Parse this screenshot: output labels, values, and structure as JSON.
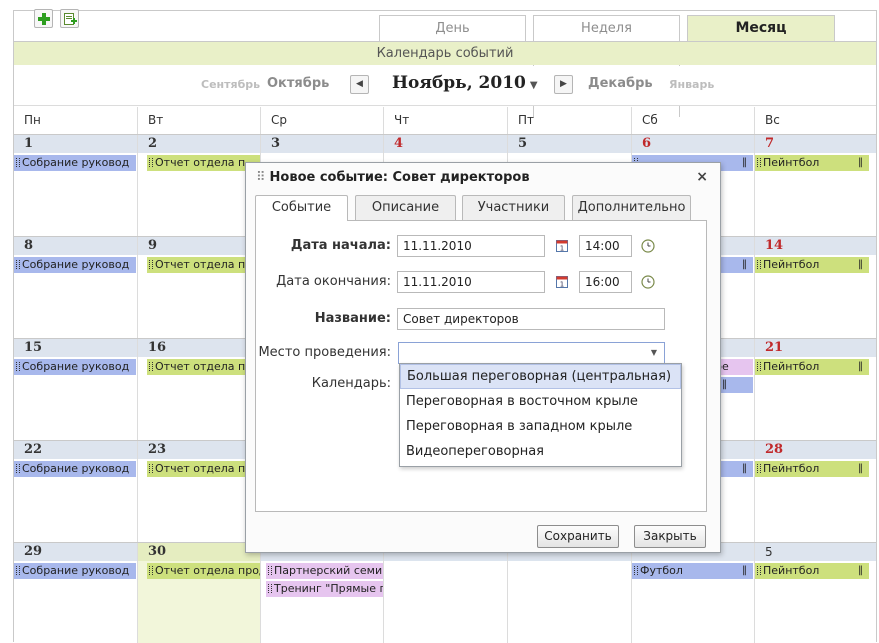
{
  "toolbar": {
    "add_icon": "plus-icon",
    "export_icon": "add-document-icon",
    "accent_green": "#2e9e1f"
  },
  "view_tabs": [
    {
      "label": "День",
      "active": false
    },
    {
      "label": "Неделя",
      "active": false
    },
    {
      "label": "Месяц",
      "active": true
    }
  ],
  "calendar": {
    "title": "Календарь событий",
    "nav": {
      "prev2": "Сентябрь",
      "prev1": "Октябрь",
      "current": "Ноябрь, 2010",
      "next1": "Декабрь",
      "next2": "Январь"
    },
    "weekdays": [
      "Пн",
      "Вт",
      "Ср",
      "Чт",
      "Пт",
      "Сб",
      "Вс"
    ],
    "weeks": [
      {
        "days": [
          "1",
          "2",
          "3",
          "4",
          "5",
          "6",
          "7"
        ]
      },
      {
        "days": [
          "8",
          "9",
          "",
          "",
          "",
          "",
          "14"
        ]
      },
      {
        "days": [
          "15",
          "16",
          "",
          "",
          "",
          "",
          "21"
        ]
      },
      {
        "days": [
          "22",
          "23",
          "",
          "",
          "",
          "",
          "28"
        ]
      },
      {
        "days": [
          "29",
          "30",
          "",
          "",
          "",
          "",
          "5"
        ]
      }
    ],
    "events": {
      "mon": "Собрание руковод",
      "tue": "Отчет отдела п",
      "tue_last": "Отчет отдела прод",
      "wed1": "Партнерский семин",
      "wed2": "Тренинг \"Прямые п",
      "sat_w3": "овое",
      "sat_w5": "Футбол",
      "sun": "Пейнтбол",
      "pause_icon": "pause-icon"
    },
    "colors": {
      "blue": "#a8b8ec",
      "green": "#cde07d",
      "pink": "#e6c5ef",
      "weekend": "#c0292b"
    }
  },
  "dialog": {
    "title": "Новое событие: Совет директоров",
    "close": "×",
    "tabs": [
      "Событие",
      "Описание",
      "Участники",
      "Дополнительно"
    ],
    "start_label": "Дата начала:",
    "start_date": "11.11.2010",
    "start_time": "14:00",
    "end_label": "Дата окончания:",
    "end_date": "11.11.2010",
    "end_time": "16:00",
    "name_label": "Название:",
    "name_value": "Совет директоров",
    "place_label": "Место проведения:",
    "place_value": "",
    "calendar_label": "Календарь:",
    "place_options": [
      "Большая переговорная (центральная)",
      "Переговорная в восточном крыле",
      "Переговорная в западном крыле",
      "Видеопереговорная"
    ],
    "save": "Сохранить",
    "close_btn": "Закрыть"
  }
}
